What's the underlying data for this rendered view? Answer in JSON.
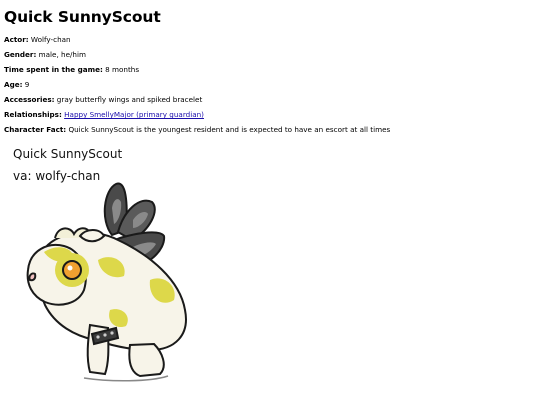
{
  "header": {
    "title": "Quick SunnyScout"
  },
  "fields": [
    {
      "label": "Actor:",
      "value": "Wolfy-chan"
    },
    {
      "label": "Gender:",
      "value": "male, he/him"
    },
    {
      "label": "Time spent in the game:",
      "value": "8 months"
    },
    {
      "label": "Age:",
      "value": "9"
    },
    {
      "label": "Accessories:",
      "value": "gray butterfly wings and spiked bracelet"
    },
    {
      "label": "Relationships:",
      "link": "Happy SmellyMajor (primary guardian)"
    },
    {
      "label": "Character Fact:",
      "value": "Quick SunnyScout is the youngest resident and is expected to have an escort at all times"
    }
  ],
  "artwork": {
    "caption_name": "Quick SunnyScout",
    "caption_va": "va: wolfy-chan",
    "colors": {
      "body": "#f7f4e9",
      "patch": "#ddd84a",
      "wing": "#4a4a4a",
      "wing_light": "#8a8a8a",
      "eye": "#f0a030",
      "outline": "#1a1a1a"
    }
  }
}
